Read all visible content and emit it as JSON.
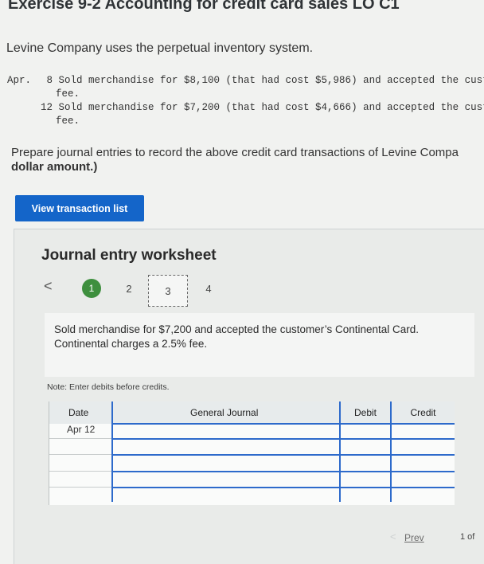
{
  "exercise_title": "Exercise 9-2 Accounting for credit card sales LO C1",
  "intro": "Levine Company uses the perpetual inventory system.",
  "transactions": {
    "month": "Apr.",
    "line1": " 8 Sold merchandise for $8,100 (that had cost $5,986) and accepted the custo",
    "line1b": "fee.",
    "line2": "12 Sold merchandise for $7,200 (that had cost $4,666) and accepted the custom",
    "line2b": "fee."
  },
  "prompt": {
    "line1": "Prepare journal entries to record the above credit card transactions of Levine Compa",
    "line2": "dollar amount.)"
  },
  "view_transactions_button": "View transaction list",
  "worksheet": {
    "title": "Journal entry worksheet",
    "nav_prev": "<",
    "steps": [
      "1",
      "2",
      "3",
      "4"
    ],
    "description_line1": "Sold merchandise for $7,200 and accepted the customer’s Continental Card.",
    "description_line2": "Continental charges a 2.5% fee.",
    "note": "Note: Enter debits before credits.",
    "columns": {
      "date": "Date",
      "general_journal": "General Journal",
      "debit": "Debit",
      "credit": "Credit"
    },
    "rows": [
      {
        "date": "Apr 12"
      },
      {
        "date": ""
      },
      {
        "date": ""
      },
      {
        "date": ""
      },
      {
        "date": ""
      }
    ]
  },
  "pagination": {
    "prev": "Prev",
    "page": "1 of"
  }
}
